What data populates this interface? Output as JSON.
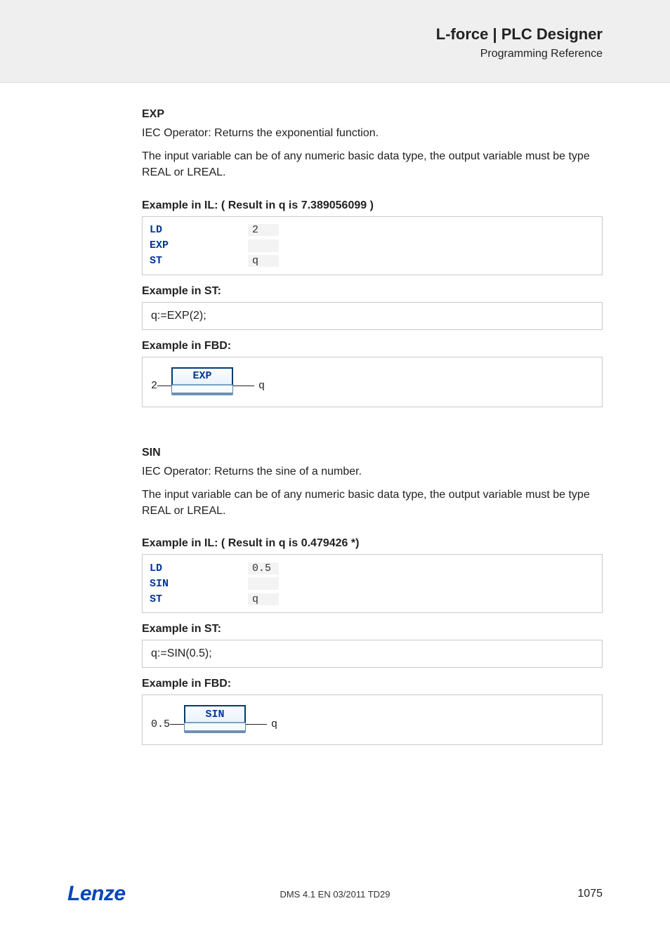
{
  "header": {
    "brand": "L-force | PLC Designer",
    "subtitle": "Programming Reference"
  },
  "sections": [
    {
      "title": "EXP",
      "intro1": "IEC Operator: Returns the exponential function.",
      "intro2": "The input variable can be of any numeric basic data type, the output variable must be type REAL or LREAL.",
      "il_title": "Example in IL: ( Result in q is 7.389056099 )",
      "il_rows": [
        {
          "kw": "LD",
          "arg": "2"
        },
        {
          "kw": "EXP",
          "arg": ""
        },
        {
          "kw": "ST",
          "arg": "q"
        }
      ],
      "st_title": "Example in ST:",
      "st_code": "q:=EXP(2);",
      "fbd_title": "Example in FBD:",
      "fbd": {
        "in": "2",
        "block": "EXP",
        "out": "q"
      }
    },
    {
      "title": "SIN",
      "intro1": "IEC Operator: Returns the sine of a number.",
      "intro2": "The input variable can be of any numeric basic data type, the output variable must be type REAL or LREAL.",
      "il_title": "Example in IL: ( Result in q is 0.479426 *)",
      "il_rows": [
        {
          "kw": "LD",
          "arg": "0.5"
        },
        {
          "kw": "SIN",
          "arg": ""
        },
        {
          "kw": "ST",
          "arg": "q"
        }
      ],
      "st_title": "Example in ST:",
      "st_code": "q:=SIN(0.5);",
      "fbd_title": "Example in FBD:",
      "fbd": {
        "in": "0.5",
        "block": "SIN",
        "out": "q"
      }
    }
  ],
  "footer": {
    "logo": "Lenze",
    "mid": "DMS 4.1 EN 03/2011 TD29",
    "page": "1075"
  }
}
